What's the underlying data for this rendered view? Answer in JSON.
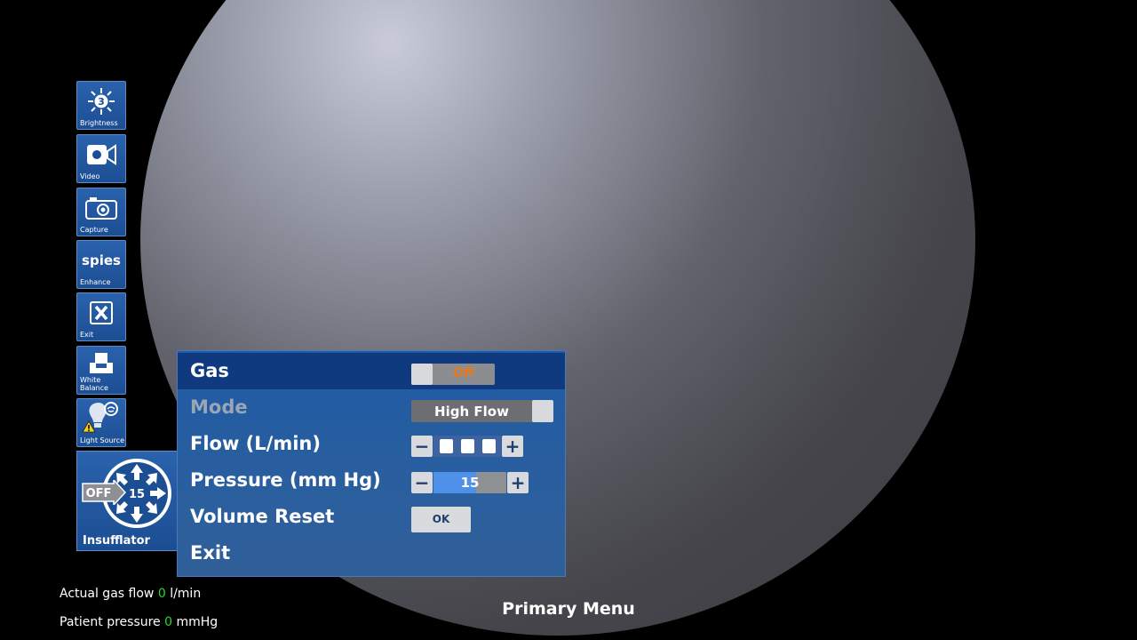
{
  "sidebar": {
    "items": [
      {
        "label": "Brightness",
        "badge": "3",
        "icon": "brightness-icon"
      },
      {
        "label": "Video",
        "icon": "video-camera-icon"
      },
      {
        "label": "Capture",
        "icon": "camera-icon"
      },
      {
        "label": "Enhance",
        "logo": "spies",
        "icon": "spies-logo"
      },
      {
        "label": "Exit",
        "icon": "close-x-icon"
      },
      {
        "label": "White Balance",
        "icon": "white-balance-icon"
      },
      {
        "label": "Light Source",
        "icon": "light-source-icon",
        "warning": true
      }
    ],
    "insufflator": {
      "label": "Insufflator",
      "state": "OFF",
      "value": "15"
    }
  },
  "menu": {
    "rows": [
      {
        "label": "Gas",
        "control": "toggle",
        "value": "Off",
        "selected": true
      },
      {
        "label": "Mode",
        "control": "toggle",
        "value": "High Flow",
        "disabled": true
      },
      {
        "label": "Flow (L/min)",
        "control": "stepper",
        "level": 3
      },
      {
        "label": "Pressure (mm Hg)",
        "control": "stepper",
        "value": "15"
      },
      {
        "label": "Volume Reset",
        "control": "button",
        "value": "OK"
      },
      {
        "label": "Exit"
      }
    ]
  },
  "status": {
    "gas_flow": {
      "prefix": "Actual gas flow",
      "value": "0",
      "unit": "l/min"
    },
    "pressure": {
      "prefix": "Patient pressure",
      "value": "0",
      "unit": "mmHg"
    }
  },
  "footer_title": "Primary Menu",
  "colors": {
    "accent": "#1f5aa3",
    "selected_row": "#0f3a80",
    "off_text": "#e8781a",
    "status_value": "#2ed62e",
    "pressure_fill": "#4f91e8"
  }
}
